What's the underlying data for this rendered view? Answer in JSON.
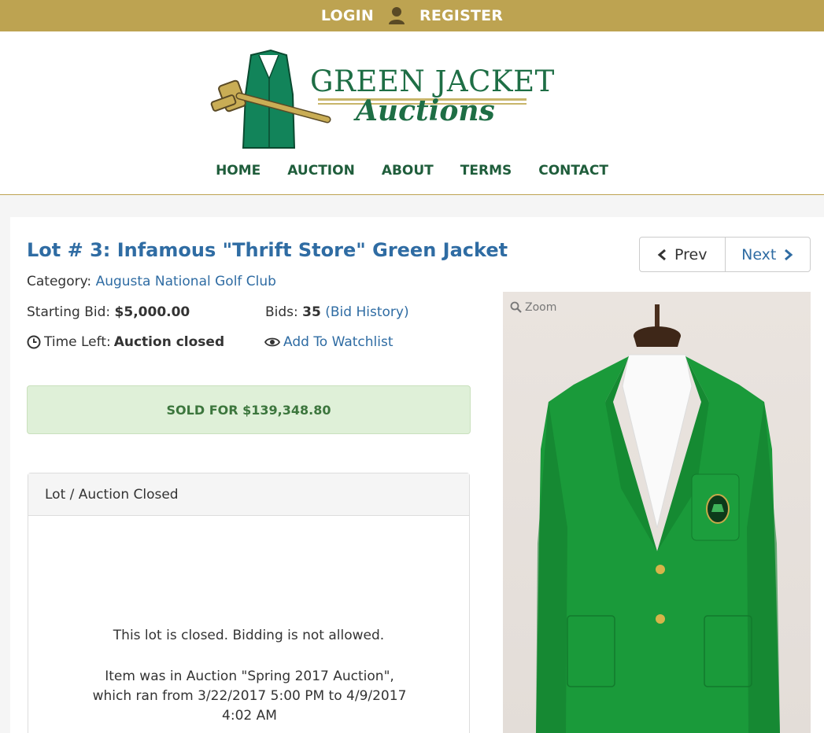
{
  "topbar": {
    "login": "LOGIN",
    "register": "REGISTER"
  },
  "logo": {
    "line1": "GREEN JACKET",
    "line2": "Auctions"
  },
  "nav": [
    "HOME",
    "AUCTION",
    "ABOUT",
    "TERMS",
    "CONTACT"
  ],
  "lot": {
    "title": "Lot # 3: Infamous \"Thrift Store\" Green Jacket",
    "category_label": "Category:",
    "category_value": "Augusta National Golf Club",
    "starting_bid_label": "Starting Bid:",
    "starting_bid_value": "$5,000.00",
    "bids_label": "Bids:",
    "bids_value": "35",
    "bid_history": "(Bid History)",
    "time_left_label": "Time Left:",
    "time_left_value": "Auction closed",
    "watchlist": "Add To Watchlist",
    "sold": "SOLD FOR $139,348.80"
  },
  "closed_panel": {
    "heading": "Lot / Auction Closed",
    "message": "This lot is closed. Bidding is not allowed.",
    "detail": "Item was in Auction \"Spring 2017 Auction\", which ran from 3/22/2017 5:00 PM to 4/9/2017 4:02 AM"
  },
  "pager": {
    "prev": "Prev",
    "next": "Next"
  },
  "photo": {
    "zoom": "Zoom"
  },
  "colors": {
    "gold": "#bda351",
    "link": "#2f6ca3",
    "nav": "#1f5d3b",
    "success_bg": "#dff0d8",
    "success_text": "#3c763d"
  }
}
